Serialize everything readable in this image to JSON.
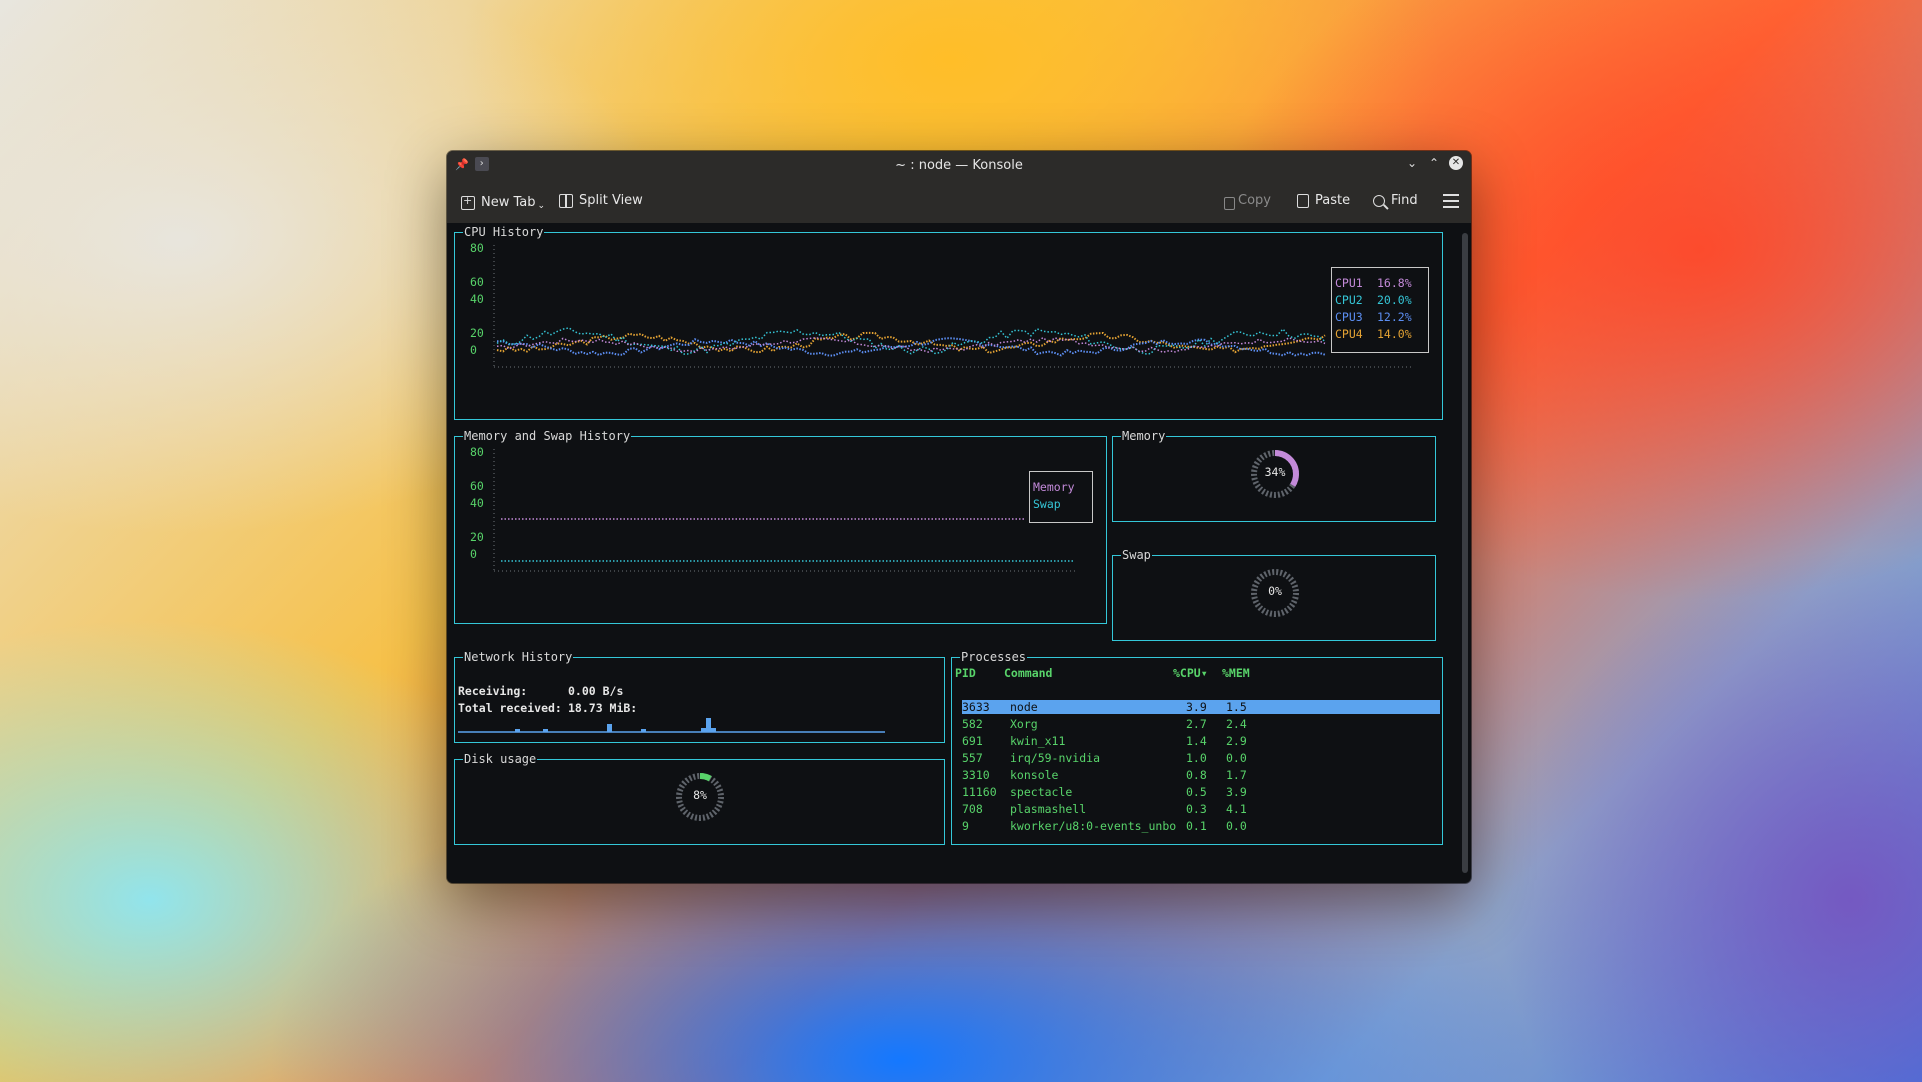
{
  "window": {
    "title": "~ : node — Konsole"
  },
  "toolbar": {
    "new_tab": "New Tab",
    "split_view": "Split View",
    "copy": "Copy",
    "paste": "Paste",
    "find": "Find"
  },
  "cpu": {
    "title": "CPU History",
    "y_ticks": [
      "80",
      "60",
      "40",
      "20",
      "0"
    ],
    "legend": [
      {
        "label": "CPU1",
        "value": "16.8%",
        "color": "#c38ad9"
      },
      {
        "label": "CPU2",
        "value": "20.0%",
        "color": "#35c5d6"
      },
      {
        "label": "CPU3",
        "value": "12.2%",
        "color": "#5c8ef2"
      },
      {
        "label": "CPU4",
        "value": "14.0%",
        "color": "#e3a233"
      }
    ]
  },
  "memhist": {
    "title": "Memory and Swap History",
    "y_ticks": [
      "80",
      "60",
      "40",
      "20",
      "0"
    ],
    "legend": [
      {
        "label": "Memory",
        "color": "#c38ad9"
      },
      {
        "label": "Swap",
        "color": "#35c5d6"
      }
    ]
  },
  "memory": {
    "title": "Memory",
    "percent": "34%",
    "fraction": 0.34
  },
  "swap": {
    "title": "Swap",
    "percent": "0%",
    "fraction": 0.0
  },
  "network": {
    "title": "Network History",
    "receiving_label": "Receiving:",
    "receiving_value": "0.00 B/s",
    "total_label": "Total received:",
    "total_value": "18.73 MiB:"
  },
  "disk": {
    "title": "Disk usage",
    "percent": "8%",
    "fraction": 0.08
  },
  "processes": {
    "title": "Processes",
    "headers": {
      "pid": "PID",
      "command": "Command",
      "cpu": "%CPU▾",
      "mem": "%MEM"
    },
    "rows": [
      {
        "pid": "3633",
        "command": "node",
        "cpu": "3.9",
        "mem": "1.5"
      },
      {
        "pid": "582",
        "command": "Xorg",
        "cpu": "2.7",
        "mem": "2.4"
      },
      {
        "pid": "691",
        "command": "kwin_x11",
        "cpu": "1.4",
        "mem": "2.9"
      },
      {
        "pid": "557",
        "command": "irq/59-nvidia",
        "cpu": "1.0",
        "mem": "0.0"
      },
      {
        "pid": "3310",
        "command": "konsole",
        "cpu": "0.8",
        "mem": "1.7"
      },
      {
        "pid": "11160",
        "command": "spectacle",
        "cpu": "0.5",
        "mem": "3.9"
      },
      {
        "pid": "708",
        "command": "plasmashell",
        "cpu": "0.3",
        "mem": "4.1"
      },
      {
        "pid": "9",
        "command": "kworker/u8:0-events_unbo",
        "cpu": "0.1",
        "mem": "0.0"
      }
    ]
  },
  "colors": {
    "border": "#34c7d8",
    "text_green": "#58d36a",
    "selection": "#5ba3ee"
  }
}
